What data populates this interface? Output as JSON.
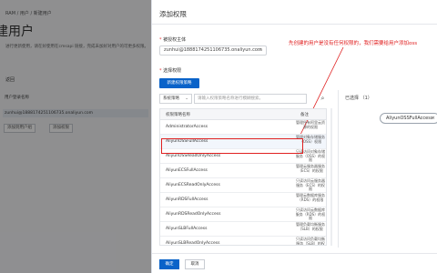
{
  "background": {
    "breadcrumb": "RAM / 用户 / 新建用户",
    "title": "建用户",
    "desc": "进行更新使用，请在好使用在cmsapi 链接，完成未加好对用户的可更多权限。",
    "action": "返回",
    "label1": "用户登录名称",
    "row_value": "zunhui@1888174251106735.onaliyun.com",
    "btn1": "添加到用户组",
    "btn2": "添加权限"
  },
  "panel": {
    "title": "添加权限",
    "principal_label": "被授权主体",
    "principal_value": "zunhui@1888174251106735.onaliyun.com",
    "annotation": "先创建的用户是没有任何权限的，我们需要给用户添加oss",
    "select_label": "选择权限",
    "create_button": "新建权限策略",
    "filter_select": "系统策略",
    "search_placeholder": "请输入权限策略名称进行模糊搜索。",
    "col_name": "权限策略名称",
    "col_desc": "备注",
    "rows": [
      {
        "name": "AdministratorAccess",
        "desc": "管理所有阿里云资源的权限"
      },
      {
        "name": "AliyunOSSFullAccess",
        "desc": "管理对象存储服务（OSS）权限"
      },
      {
        "name": "AliyunOSSReadOnlyAccess",
        "desc": "只读访问对象存储服务（OSS）的权限"
      },
      {
        "name": "AliyunECSFullAccess",
        "desc": "管理云服务器服务（ECS）的权限"
      },
      {
        "name": "AliyunECSReadOnlyAccess",
        "desc": "只读访问云服务器服务（ECS）的权限"
      },
      {
        "name": "AliyunRDSFullAccess",
        "desc": "管理云数据库服务（RDS）的权限"
      },
      {
        "name": "AliyunRDSReadOnlyAccess",
        "desc": "只读访问云数据库服务（RDS）的权限"
      },
      {
        "name": "AliyunSLBFullAccess",
        "desc": "管理负载均衡服务（SLB）的权限"
      },
      {
        "name": "AliyunSLBReadOnlyAccess",
        "desc": "只读访问负载均衡服务（SLB）的权限"
      }
    ],
    "chosen_label": "已选择 （1）",
    "chosen_item": "AliyunOSSFullAccess",
    "ok_button": "确定",
    "cancel_button": "取消"
  }
}
